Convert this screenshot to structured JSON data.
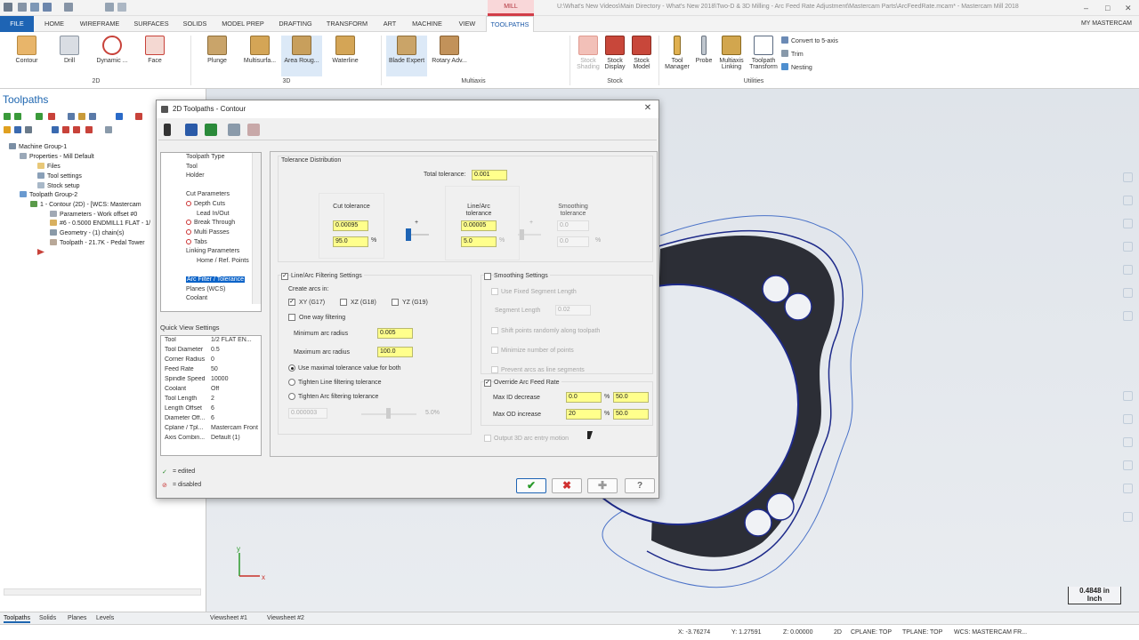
{
  "titlebar": {
    "context_tab": "MILL",
    "title": "U:\\What's New Videos\\Main Directory - What's New 2018\\Two-D & 3D Milling - Arc Feed Rate Adjustment\\Mastercam Parts\\ArcFeedRate.mcam* - Mastercam Mill 2018",
    "controls": [
      "–",
      "□",
      "✕"
    ]
  },
  "tabs": [
    "FILE",
    "HOME",
    "WIREFRAME",
    "SURFACES",
    "SOLIDS",
    "MODEL PREP",
    "DRAFTING",
    "TRANSFORM",
    "ART",
    "MACHINE",
    "VIEW",
    "TOOLPATHS"
  ],
  "my_mastercam": "MY MASTERCAM",
  "ribbon": {
    "twod": [
      "Contour",
      "Drill",
      "Dynamic ...",
      "Face"
    ],
    "threed": [
      "Plunge",
      "Multisurfa...",
      "Area Roug...",
      "Waterline"
    ],
    "multiaxis": [
      "Blade Expert",
      "Rotary Adv..."
    ],
    "stock": [
      "Stock Shading",
      "Stock Display",
      "Stock Model"
    ],
    "utilities": [
      "Tool Manager",
      "Probe",
      "Multiaxis Linking",
      "Toolpath Transform"
    ],
    "small": [
      "Convert to 5-axis",
      "Trim",
      "Nesting"
    ],
    "groups": [
      "2D",
      "3D",
      "Multiaxis",
      "Stock",
      "Utilities"
    ]
  },
  "toolpaths_panel": {
    "title": "Toolpaths",
    "tree": [
      "Machine Group-1",
      "Properties - Mill Default",
      "Files",
      "Tool settings",
      "Stock setup",
      "Toolpath Group-2",
      "1 - Contour (2D) - [WCS: Mastercam",
      "Parameters - Work offset #0",
      "#6 - 0.5000 ENDMILL1 FLAT - 1/",
      "Geometry - (1) chain(s)",
      "Toolpath - 21.7K - Pedal Tower"
    ]
  },
  "bottom_tabs": [
    "Toolpaths",
    "Solids",
    "Planes",
    "Levels",
    "Viewsheet #1",
    "Viewsheet #2"
  ],
  "status": {
    "x": "X:  -3.76274",
    "y": "Y:  1.27591",
    "z": "Z:  0.00000",
    "mode": "2D",
    "cplane": "CPLANE: TOP",
    "tplane": "TPLANE: TOP",
    "wcs": "WCS: MASTERCAM FR..."
  },
  "viewport": {
    "scale_value": "0.4848 in",
    "scale_unit": "Inch",
    "axis_x": "x",
    "axis_y": "y"
  },
  "dialog": {
    "title": "2D Toolpaths - Contour",
    "nav": [
      "Toolpath Type",
      "Tool",
      "Holder",
      "Cut Parameters",
      "Depth Cuts",
      "Lead In/Out",
      "Break Through",
      "Multi Passes",
      "Tabs",
      "Linking Parameters",
      "Home / Ref. Points",
      "Arc Filter / Tolerance",
      "Planes (WCS)",
      "Coolant"
    ],
    "quick_view_title": "Quick View Settings",
    "quick_view": [
      [
        "Tool",
        "1/2 FLAT EN..."
      ],
      [
        "Tool Diameter",
        "0.5"
      ],
      [
        "Corner Radius",
        "0"
      ],
      [
        "Feed Rate",
        "50"
      ],
      [
        "Spindle Speed",
        "10000"
      ],
      [
        "Coolant",
        "Off"
      ],
      [
        "Tool Length",
        "2"
      ],
      [
        "Length Offset",
        "6"
      ],
      [
        "Diameter Off...",
        "6"
      ],
      [
        "Cplane / Tpl...",
        "Mastercam Front"
      ],
      [
        "Axis Combin...",
        "Default (1)"
      ]
    ],
    "legend_edited": "= edited",
    "legend_disabled": "= disabled",
    "tol": {
      "section": "Tolerance Distribution",
      "total_label": "Total tolerance:",
      "total": "0.001",
      "cut_label": "Cut tolerance",
      "cut": "0.00095",
      "cut_pct": "95.0",
      "linearc_label": "Line/Arc tolerance",
      "linearc": "0.00005",
      "linearc_pct": "5.0",
      "smooth_label": "Smoothing tolerance",
      "smooth": "0.0",
      "smooth_pct": "0.0",
      "pct": "%",
      "plus": "+"
    },
    "filter": {
      "title": "Line/Arc Filtering Settings",
      "create_arcs": "Create arcs in:",
      "xy": "XY (G17)",
      "xz": "XZ (G18)",
      "yz": "YZ (G19)",
      "one_way": "One way filtering",
      "min_label": "Minimum arc radius",
      "min": "0.005",
      "max_label": "Maximum arc radius",
      "max": "100.0",
      "opt1": "Use maximal tolerance value for both",
      "opt2": "Tighten Line filtering tolerance",
      "opt3": "Tighten Arc filtering tolerance",
      "slider_value": "0.000003",
      "slider_pct": "5.0%"
    },
    "smooth": {
      "title": "Smoothing Settings",
      "fixed": "Use Fixed Segment Length",
      "seg_label": "Segment Length",
      "seg": "0.02",
      "shift": "Shift points randomly along toolpath",
      "minimize": "Minimize number of points",
      "prevent": "Prevent arcs as line segments"
    },
    "override": {
      "title": "Override Arc Feed Rate",
      "id_label": "Max ID decrease",
      "id_val": "0.0",
      "id_pct": "50.0",
      "od_label": "Max OD increase",
      "od_val": "20",
      "od_pct": "50.0",
      "pct": "%"
    },
    "output3d": "Output 3D arc entry motion",
    "buttons": {
      "ok": "✔",
      "cancel": "✖",
      "add": "✚",
      "help": "?"
    }
  },
  "colors": {
    "accent": "#1e64b4",
    "highlight": "#ffff8c",
    "part": "#2c2e36",
    "toolpath": "#4a72c8"
  }
}
